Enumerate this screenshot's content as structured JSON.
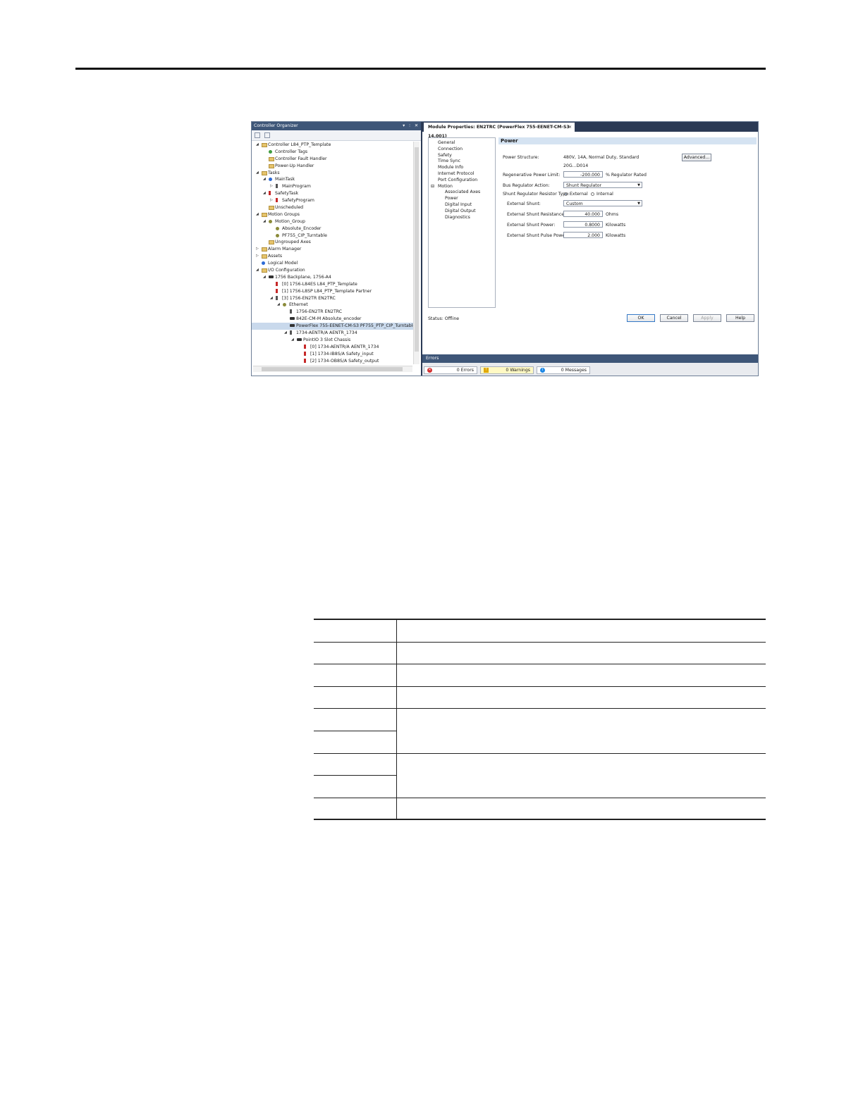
{
  "organizer": {
    "title": "Controller Organizer",
    "title_controls": [
      "▾",
      "⫶",
      "✕"
    ],
    "tree": [
      {
        "label": "Controller L84_PTP_Template",
        "icon": "folder",
        "level": 0,
        "twisty": "◢"
      },
      {
        "label": "Controller Tags",
        "icon": "green",
        "level": 1
      },
      {
        "label": "Controller Fault Handler",
        "icon": "folder",
        "level": 1
      },
      {
        "label": "Power-Up Handler",
        "icon": "folder",
        "level": 1
      },
      {
        "label": "Tasks",
        "icon": "folder",
        "level": 0,
        "twisty": "◢"
      },
      {
        "label": "MainTask",
        "icon": "blue",
        "level": 1,
        "twisty": "◢"
      },
      {
        "label": "MainProgram",
        "icon": "mod",
        "level": 2,
        "twisty": "▷"
      },
      {
        "label": "SafetyTask",
        "icon": "red",
        "level": 1,
        "twisty": "◢"
      },
      {
        "label": "SafetyProgram",
        "icon": "red",
        "level": 2,
        "twisty": "▷"
      },
      {
        "label": "Unscheduled",
        "icon": "folder",
        "level": 1
      },
      {
        "label": "Motion Groups",
        "icon": "folder",
        "level": 0,
        "twisty": "◢"
      },
      {
        "label": "Motion_Group",
        "icon": "gear",
        "level": 1,
        "twisty": "◢"
      },
      {
        "label": "Absolute_Encoder",
        "icon": "gear",
        "level": 2
      },
      {
        "label": "PF755_CIP_Turntable",
        "icon": "gear",
        "level": 2
      },
      {
        "label": "Ungrouped Axes",
        "icon": "folder",
        "level": 1
      },
      {
        "label": "Alarm Manager",
        "icon": "folder",
        "level": 0,
        "twisty": "▷"
      },
      {
        "label": "Assets",
        "icon": "folder",
        "level": 0,
        "twisty": "▷"
      },
      {
        "label": "Logical Model",
        "icon": "blue",
        "level": 0
      },
      {
        "label": "I/O Configuration",
        "icon": "folder",
        "level": 0,
        "twisty": "◢"
      },
      {
        "label": "1756 Backplane, 1756-A4",
        "icon": "io",
        "level": 1,
        "twisty": "◢"
      },
      {
        "label": "[0] 1756-L84ES L84_PTP_Template",
        "icon": "red",
        "level": 2
      },
      {
        "label": "[1] 1756-L8SP L84_PTP_Template Partner",
        "icon": "red",
        "level": 2
      },
      {
        "label": "[3] 1756-EN2TR EN2TRC",
        "icon": "mod",
        "level": 2,
        "twisty": "◢"
      },
      {
        "label": "Ethernet",
        "icon": "gear",
        "level": 3,
        "twisty": "◢"
      },
      {
        "label": "1756-EN2TR EN2TRC",
        "icon": "mod",
        "level": 4
      },
      {
        "label": "842E-CM-M Absolute_encoder",
        "icon": "io",
        "level": 4
      },
      {
        "label": "PowerFlex 755-EENET-CM-S3 PF755_PTP_CIP_Turntable",
        "icon": "io",
        "level": 4,
        "selected": true
      },
      {
        "label": "1734-AENTR/A AENTR_1734",
        "icon": "mod",
        "level": 4,
        "twisty": "◢"
      },
      {
        "label": "PointIO 3 Slot Chassis",
        "icon": "io",
        "level": 5,
        "twisty": "◢"
      },
      {
        "label": "[0] 1734-AENTR/A AENTR_1734",
        "icon": "red",
        "level": 6
      },
      {
        "label": "[1] 1734-IB8S/A Safety_input",
        "icon": "red",
        "level": 6
      },
      {
        "label": "[2] 1734-OB8S/A Safety_output",
        "icon": "red",
        "level": 6
      }
    ]
  },
  "module": {
    "tab_title": "Module Properties: EN2TRC (PowerFlex 755-EENET-CM-S3 14.001)",
    "tab_close": "×",
    "categories": [
      {
        "label": "General",
        "level": 0
      },
      {
        "label": "Connection",
        "level": 0
      },
      {
        "label": "Safety",
        "level": 0
      },
      {
        "label": "Time Sync",
        "level": 0
      },
      {
        "label": "Module Info",
        "level": 0
      },
      {
        "label": "Internet Protocol",
        "level": 0
      },
      {
        "label": "Port Configuration",
        "level": 0
      },
      {
        "label": "Motion",
        "level": 0,
        "expand": "⊟"
      },
      {
        "label": "Associated Axes",
        "level": 1
      },
      {
        "label": "Power",
        "level": 1
      },
      {
        "label": "Digital Input",
        "level": 1
      },
      {
        "label": "Digital Output",
        "level": 1
      },
      {
        "label": "Diagnostics",
        "level": 1
      }
    ],
    "panel_title": "Power",
    "power_structure_label": "Power Structure:",
    "power_structure_value": "480V, 14A, Normal Duty, Standard",
    "power_structure_code": "20G...D014",
    "advanced_button": "Advanced...",
    "regen_label": "Regenerative Power Limit:",
    "regen_value": "-200.000",
    "regen_unit": "% Regulator Rated",
    "bus_reg_label": "Bus Regulator Action:",
    "bus_reg_value": "Shunt Regulator",
    "shunt_type_label": "Shunt Regulator Resistor Type:",
    "shunt_type_external": "External",
    "shunt_type_internal": "Internal",
    "ext_shunt_label": "External Shunt:",
    "ext_shunt_value": "Custom",
    "resistance_label": "External Shunt Resistance:",
    "resistance_value": "40.000",
    "resistance_unit": "Ohms",
    "shunt_power_label": "External Shunt Power:",
    "shunt_power_value": "0.8000",
    "shunt_power_unit": "Kilowatts",
    "pulse_power_label": "External Shunt Pulse Power:",
    "pulse_power_value": "2.000",
    "pulse_power_unit": "Kilowatts",
    "status_label": "Status:",
    "status_value": "Offline",
    "buttons": {
      "ok": "OK",
      "cancel": "Cancel",
      "apply": "Apply",
      "help": "Help"
    }
  },
  "errors": {
    "title": "Errors",
    "errors_text": "0 Errors",
    "warnings_text": "0 Warnings",
    "messages_text": "0 Messages"
  },
  "colors": {
    "title_bar": "#3e5678",
    "selected_row": "#c9d9ec",
    "warning_bg": "#fff9c4"
  }
}
